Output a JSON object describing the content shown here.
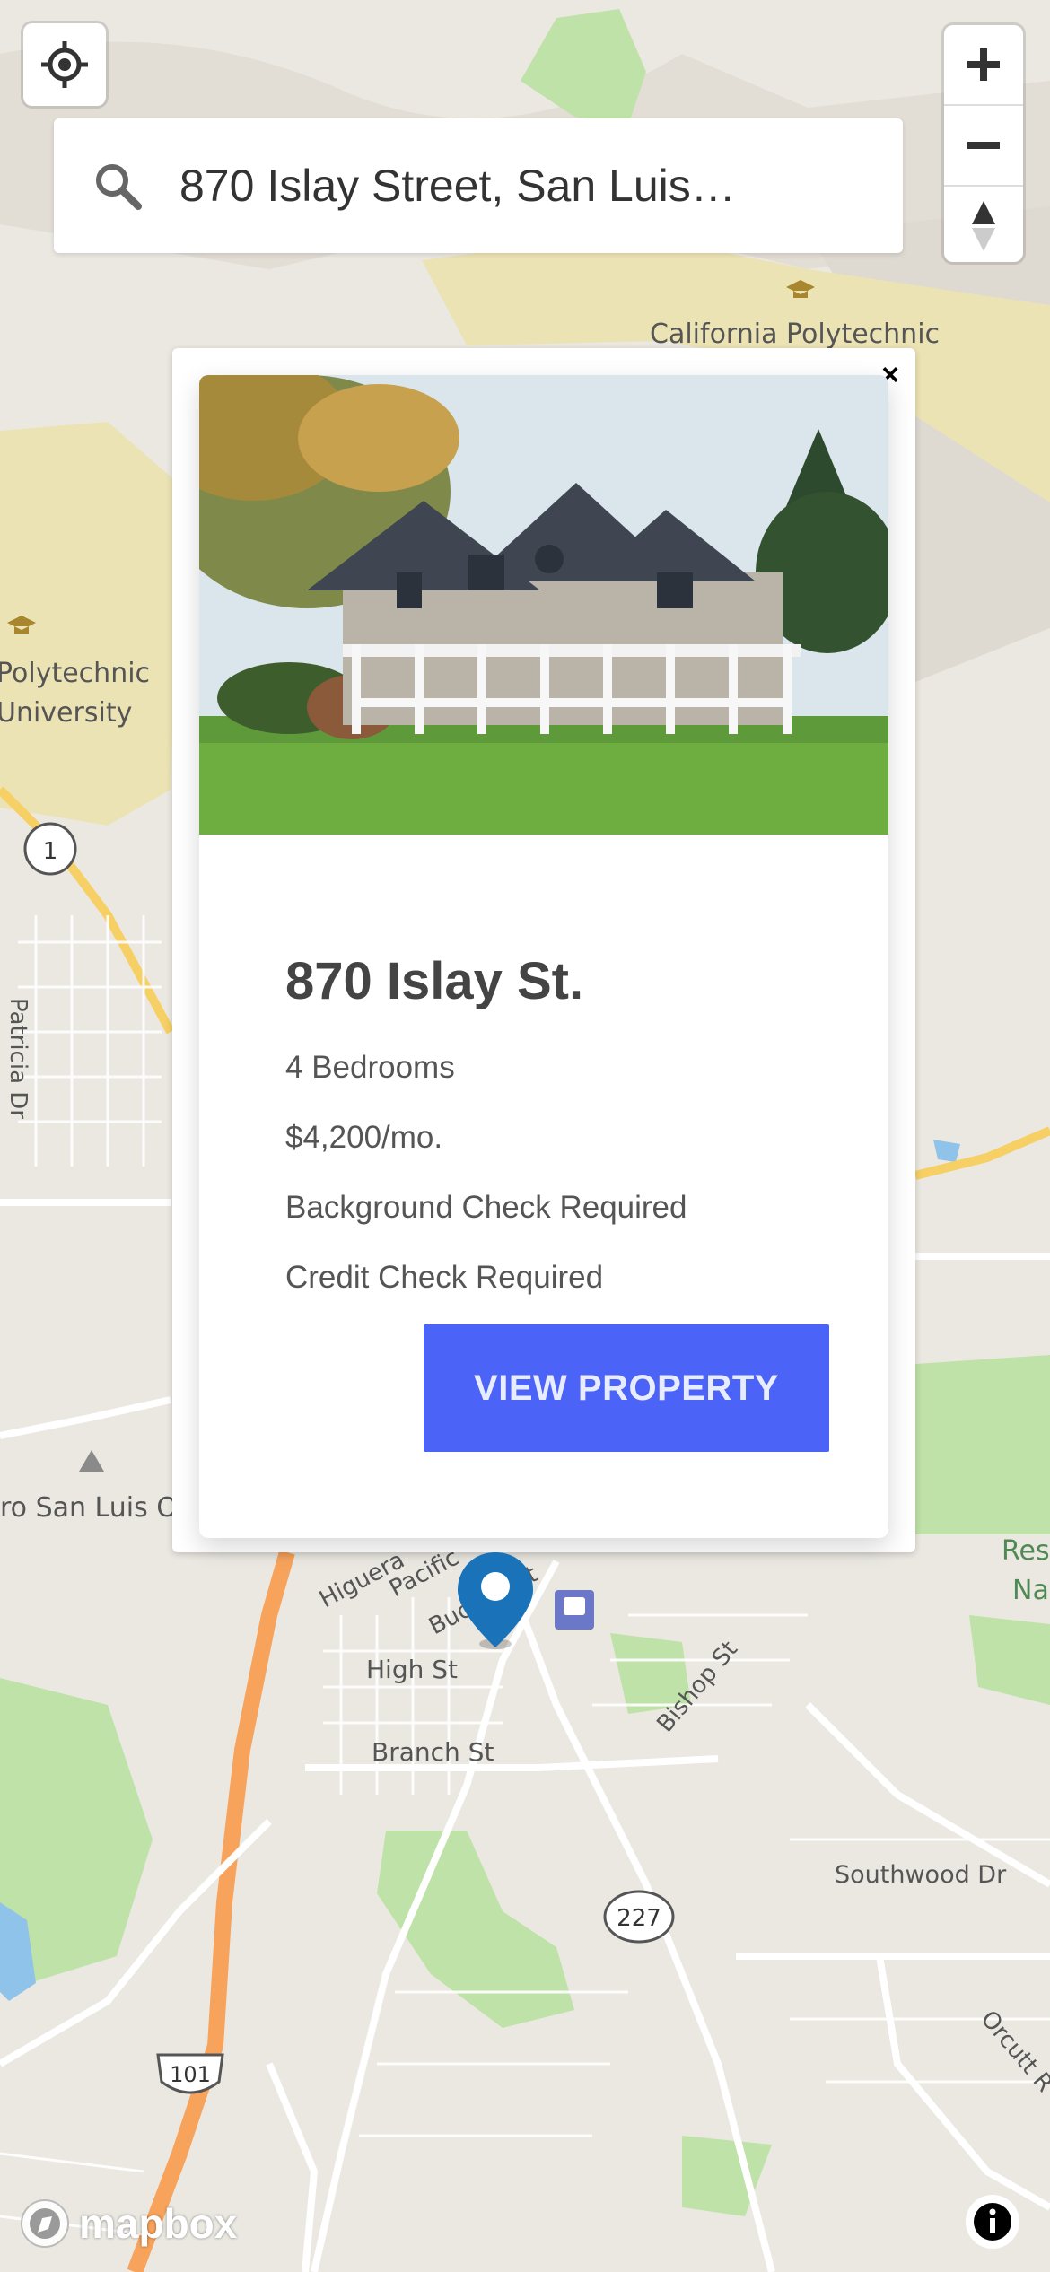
{
  "search": {
    "value": "870 Islay Street, San Luis…"
  },
  "map": {
    "labels": {
      "cal_poly_top": "California Polytechnic",
      "cal_poly_left_1": "Polytechnic",
      "cal_poly_left_2": "University",
      "patricia": "Patricia Dr",
      "cerro": "ro San Luis O",
      "higuera": "Higuera",
      "pacific": "Pacific",
      "buchon": "Buchon St",
      "high": "High St",
      "branch": "Branch St",
      "bishop": "Bishop St",
      "southwood": "Southwood Dr",
      "orcutt": "Orcutt R",
      "res": "Res",
      "na": "Na",
      "route_1": "1",
      "route_227": "227",
      "route_101": "101"
    }
  },
  "popup": {
    "close_label": "×",
    "title": "870 Islay St.",
    "bedrooms": "4 Bedrooms",
    "price": "$4,200/mo.",
    "background_check": "Background Check Required",
    "credit_check": "Credit Check Required",
    "button_label": "VIEW PROPERTY"
  },
  "attribution": {
    "logo_text": "mapbox"
  },
  "colors": {
    "button": "#4b63f7",
    "pin": "#1a73b8",
    "park": "#bfe2a8",
    "campus": "#ece3b4",
    "highway": "#f7a35c"
  },
  "icons": {
    "geolocate": "crosshair-icon",
    "search": "search-icon",
    "zoom_in": "plus-icon",
    "zoom_out": "minus-icon",
    "compass": "compass-icon",
    "pin": "map-marker-icon",
    "info": "info-icon"
  }
}
